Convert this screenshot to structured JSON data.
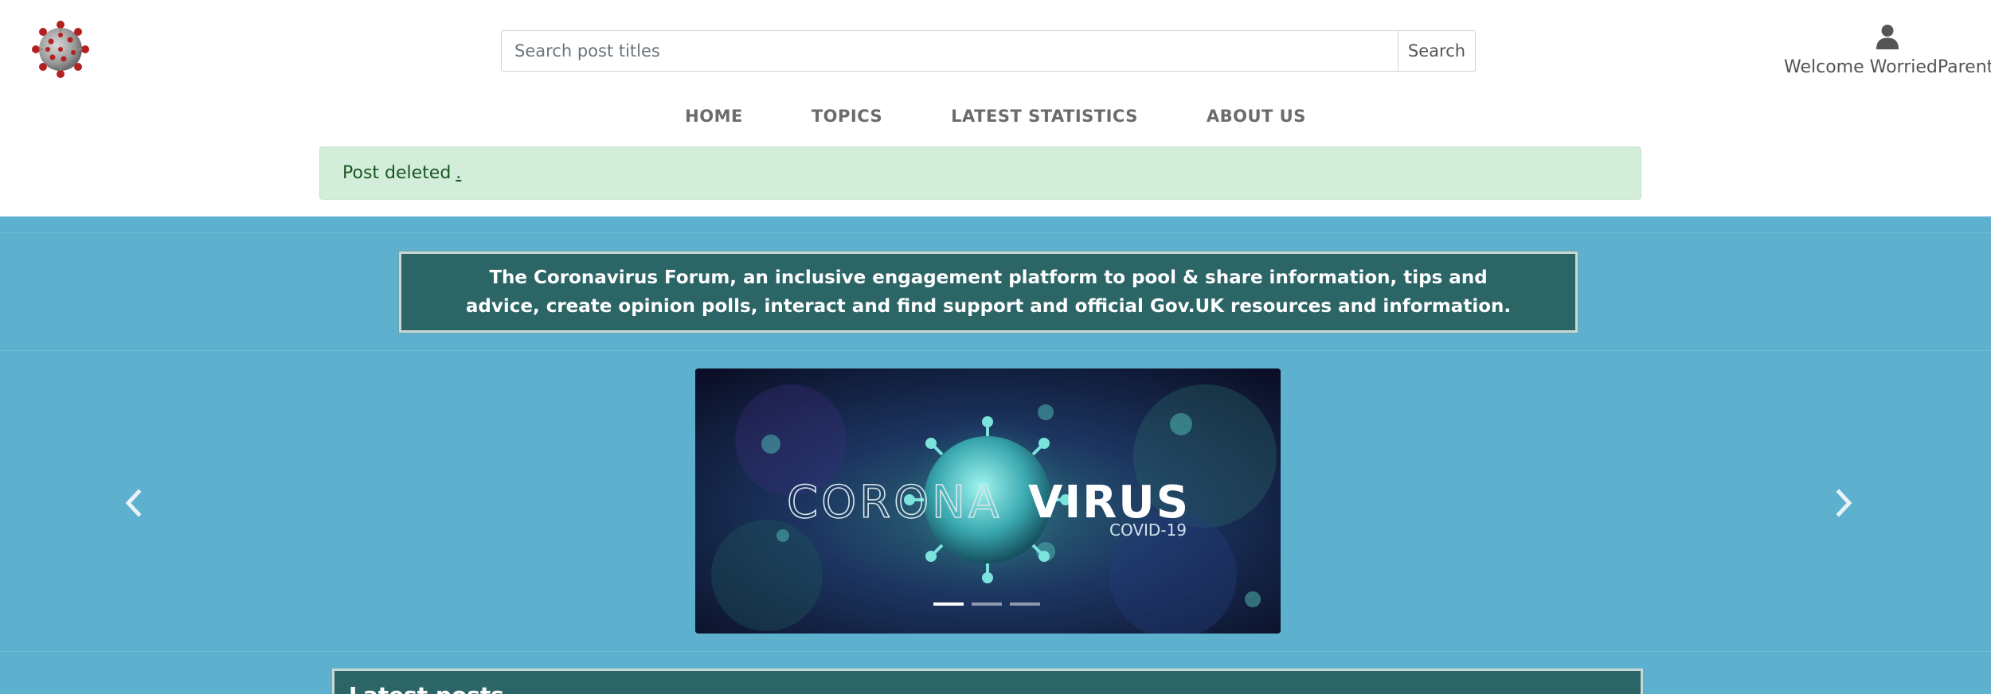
{
  "header": {
    "logo_icon": "coronavirus-logo-icon",
    "search": {
      "placeholder": "Search post titles",
      "value": "",
      "button_label": "Search"
    },
    "user": {
      "icon": "user-icon",
      "welcome_text": "Welcome WorriedParent"
    }
  },
  "nav": {
    "items": [
      {
        "label": "HOME"
      },
      {
        "label": "TOPICS"
      },
      {
        "label": "LATEST STATISTICS"
      },
      {
        "label": "ABOUT US"
      }
    ]
  },
  "alert": {
    "message": "Post deleted",
    "link_text": "."
  },
  "banner": {
    "text": "The Coronavirus Forum, an inclusive engagement platform to pool & share information, tips and advice, create opinion polls, interact and find support and official Gov.UK resources and information."
  },
  "carousel": {
    "slide_title_light": "CORONA",
    "slide_title_bold": "VIRUS",
    "slide_subtitle": "COVID-19",
    "indicator_count": 3,
    "active_index": 0,
    "prev_icon": "chevron-left-icon",
    "next_icon": "chevron-right-icon"
  },
  "latest": {
    "title": "Latest posts"
  },
  "colors": {
    "blue_section": "#5eb0cf",
    "teal_panel": "#2c6566",
    "alert_bg": "#d4edda",
    "alert_text": "#155724",
    "nav_text": "#6b6b6b"
  }
}
